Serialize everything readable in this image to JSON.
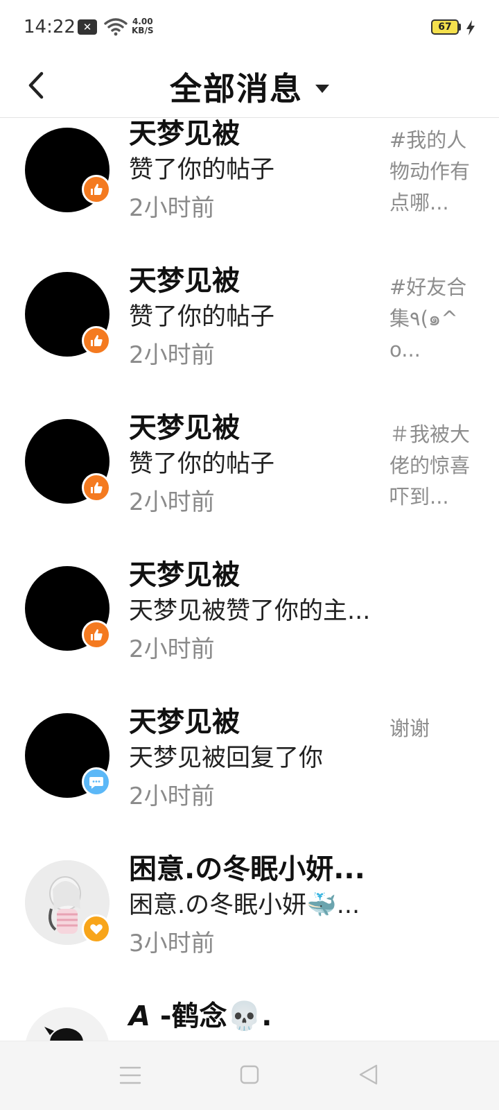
{
  "status_bar": {
    "time": "14:22",
    "net_speed_value": "4.00",
    "net_speed_unit": "KB/S",
    "battery": "67"
  },
  "header": {
    "title": "全部消息"
  },
  "messages": [
    {
      "name": "天梦见被",
      "action": "赞了你的帖子",
      "time": "2小时前",
      "preview": "#我的人物动作有点哪...",
      "badge": "like-icon"
    },
    {
      "name": "天梦见被",
      "action": "赞了你的帖子",
      "time": "2小时前",
      "preview": "#好友合集٩(๑^o...",
      "badge": "like-icon"
    },
    {
      "name": "天梦见被",
      "action": "赞了你的帖子",
      "time": "2小时前",
      "preview": "＃我被大佬的惊喜吓到...",
      "badge": "like-icon"
    },
    {
      "name": "天梦见被",
      "action": "天梦见被赞了你的主...",
      "time": "2小时前",
      "preview": "",
      "badge": "like-icon"
    },
    {
      "name": "天梦见被",
      "action": "天梦见被回复了你",
      "time": "2小时前",
      "preview": "谢谢",
      "badge": "reply-icon"
    },
    {
      "name": "困意.の冬眠小妍...",
      "action": "困意.の冬眠小妍🐳...",
      "time": "3小时前",
      "preview": "",
      "badge": "heart-icon"
    },
    {
      "name": "𝘼 -鹤念💀.",
      "action": "",
      "time": "",
      "preview": "",
      "badge": ""
    }
  ],
  "colors": {
    "like_badge": "#f47a20",
    "reply_badge": "#5cb8f7",
    "heart_badge": "#f8a51a",
    "secondary_text": "#8a8a8a"
  }
}
